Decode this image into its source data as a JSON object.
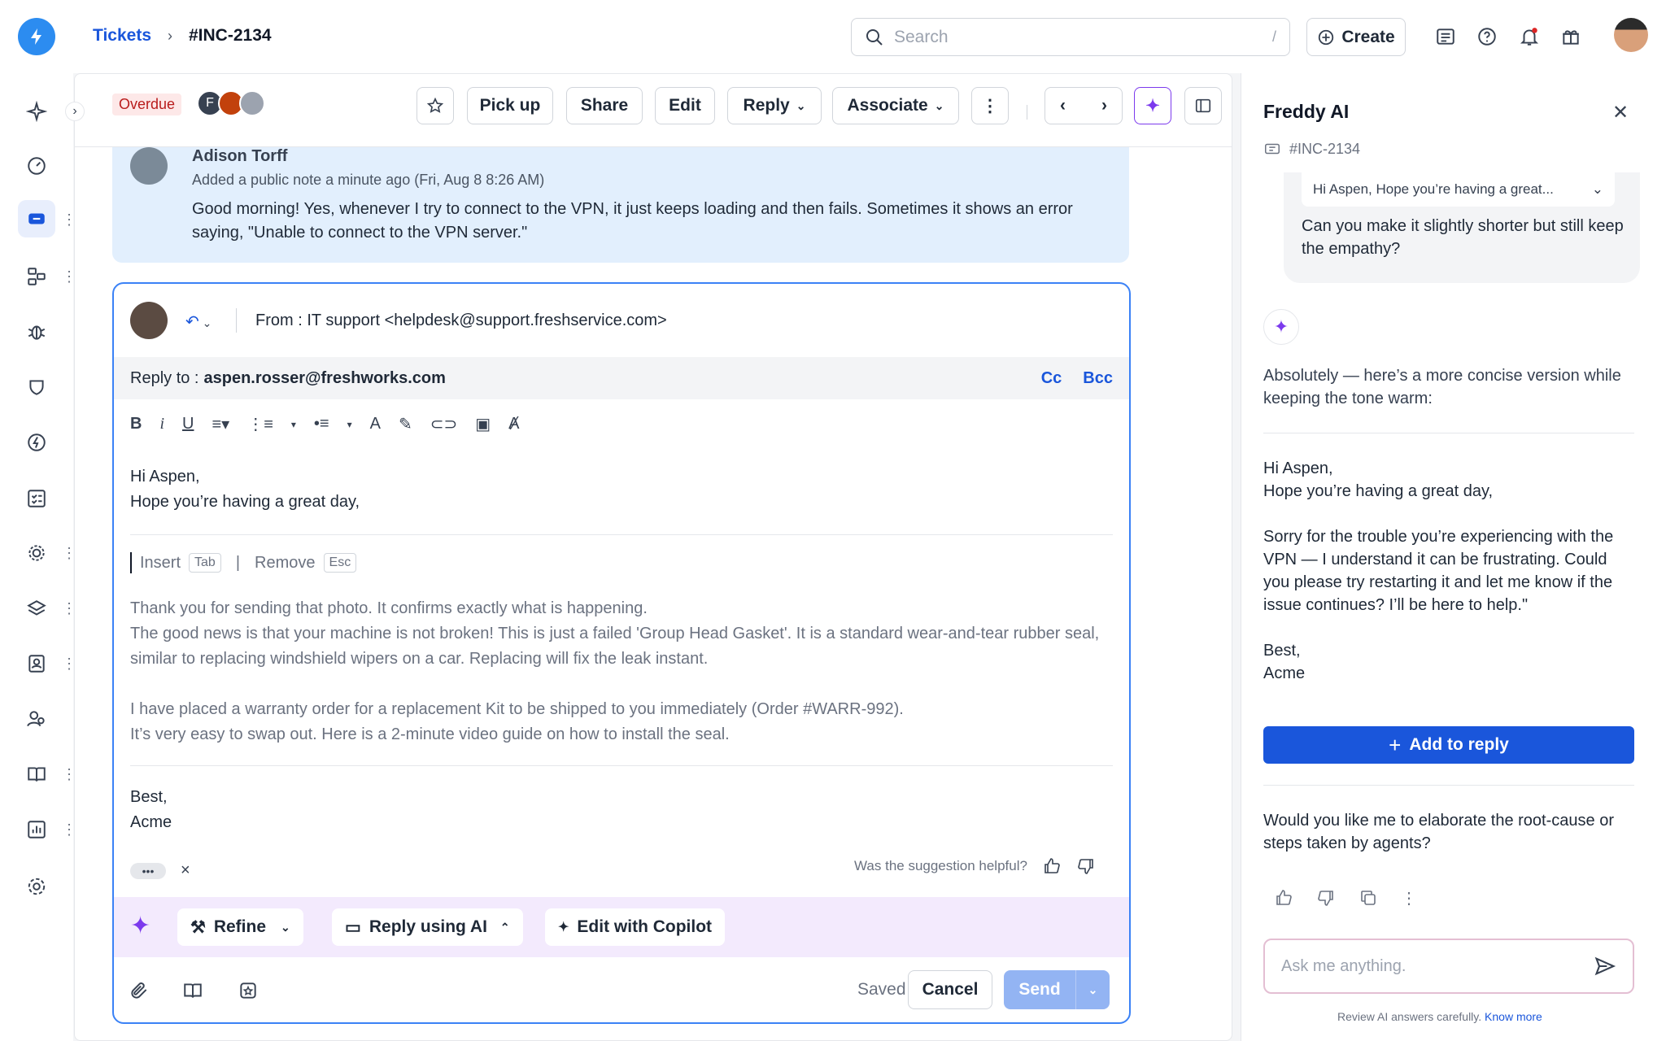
{
  "header": {
    "breadcrumb_root": "Tickets",
    "breadcrumb_current": "#INC-2134",
    "search_placeholder": "Search",
    "search_shortcut": "/",
    "create_label": "Create"
  },
  "toolbar": {
    "status_badge": "Overdue",
    "agent_initial": "F",
    "pickup_label": "Pick up",
    "share_label": "Share",
    "edit_label": "Edit",
    "reply_label": "Reply",
    "associate_label": "Associate"
  },
  "note": {
    "author": "Adison Torff",
    "meta": "Added a public note a minute ago (Fri, Aug 8 8:26 AM)",
    "text": "Good morning! Yes, whenever I try to connect to the VPN, it just keeps loading and then fails. Sometimes it shows an error saying, \"Unable to connect to the VPN server.\""
  },
  "editor": {
    "from_label": "From :",
    "from_value": "IT support <helpdesk@support.freshservice.com>",
    "reply_to_label": "Reply to :",
    "reply_to_value": "aspen.rosser@freshworks.com",
    "cc_label": "Cc",
    "bcc_label": "Bcc",
    "greeting_line1": "Hi Aspen,",
    "greeting_line2": "Hope you’re having a great day,",
    "insert_label": "Insert",
    "insert_key": "Tab",
    "remove_label": "Remove",
    "remove_key": "Esc",
    "suggestion_lines": [
      "Thank you for sending that photo. It confirms exactly what is happening.",
      "The good news is that your machine is not broken! This is just a failed 'Group Head Gasket'. It is a standard wear-and-tear rubber seal, similar to replacing windshield wipers on a car. Replacing will fix the leak instant.",
      "I have placed a warranty order for a replacement Kit to be shipped to you immediately (Order #WARR-992).",
      "It’s very easy to swap out. Here is a 2-minute video guide on how to install the seal."
    ],
    "signoff_line1": "Best,",
    "signoff_line2": "Acme",
    "more_label": "•••",
    "dismiss_label": "×",
    "helpful_label": "Was the suggestion helpful?",
    "refine_label": "Refine",
    "reply_ai_label": "Reply using AI",
    "copilot_label": "Edit with Copilot",
    "saved_label": "Saved",
    "cancel_label": "Cancel",
    "send_label": "Send"
  },
  "panel": {
    "title": "Freddy AI",
    "ticket_ref": "#INC-2134",
    "quote_preview": "Hi Aspen, Hope you’re having a great...",
    "user_question": "Can you make it slightly shorter but still keep the empathy?",
    "ai_intro": "Absolutely — here’s a more concise version while keeping the tone warm:",
    "draft_line1": "Hi Aspen,",
    "draft_line2": "Hope you’re having a great day,",
    "draft_body": "Sorry for the trouble you’re experiencing with the VPN — I understand it can be frustrating. Could you please try restarting it and let me know if the issue continues? I’ll be here to help.\"",
    "draft_sign1": "Best,",
    "draft_sign2": "Acme",
    "add_to_reply": "Add to reply",
    "followup": "Would you like me to elaborate the root-cause or steps taken by agents?",
    "ask_placeholder": "Ask me anything.",
    "disclaimer": "Review AI answers carefully.",
    "know_more": "Know more"
  },
  "colors": {
    "accent": "#1a56db",
    "note_bg": "#e2effd",
    "ai_bar_bg": "#f3eafd",
    "overdue_bg": "#fde8e8"
  }
}
